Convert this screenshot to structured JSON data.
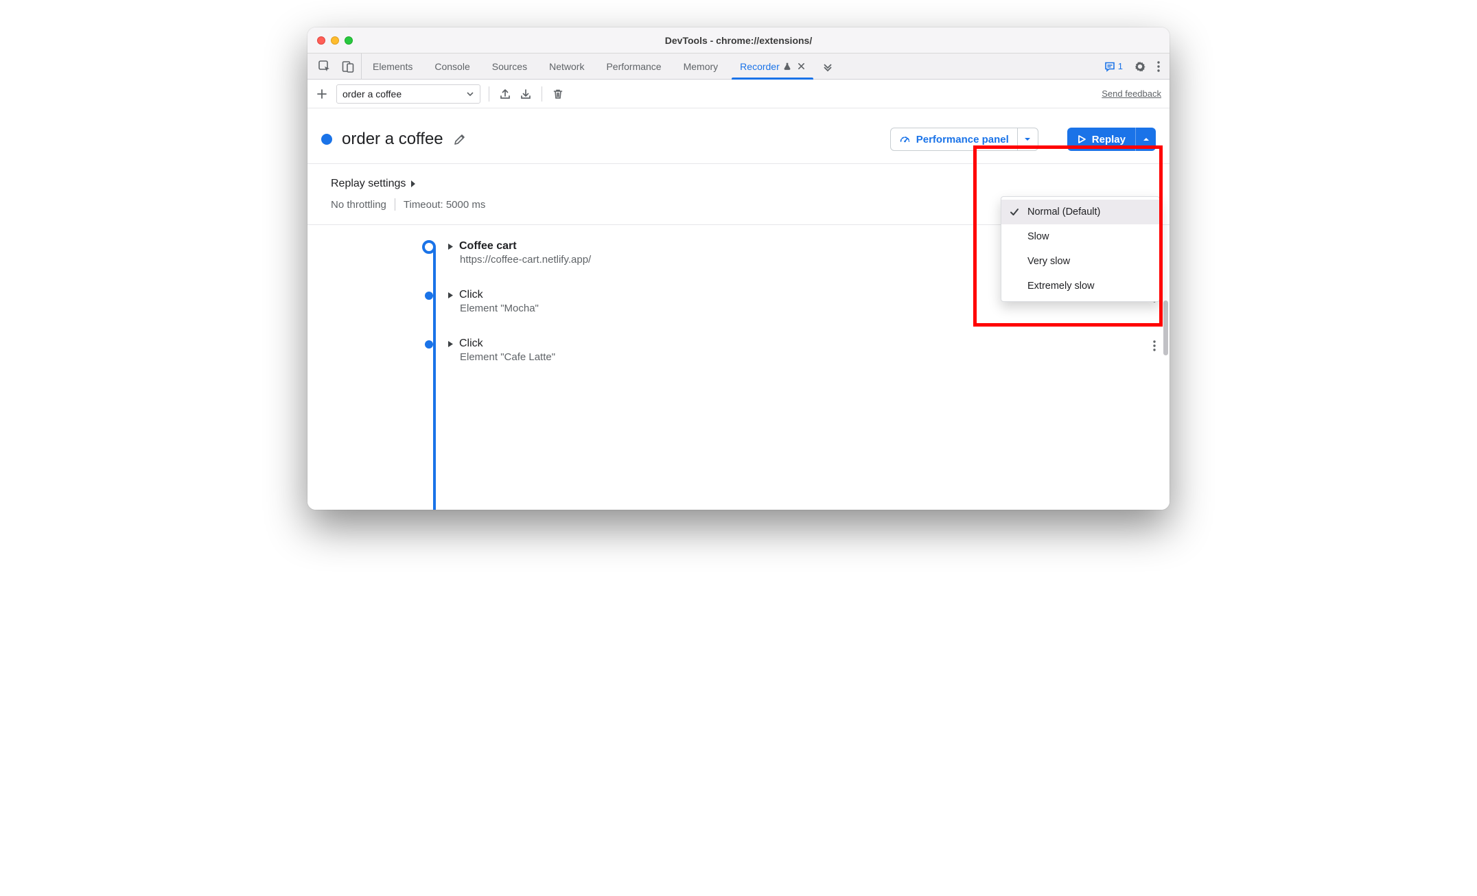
{
  "window": {
    "title": "DevTools - chrome://extensions/"
  },
  "tabs": {
    "items": [
      "Elements",
      "Console",
      "Sources",
      "Network",
      "Performance",
      "Memory",
      "Recorder"
    ],
    "active": "Recorder"
  },
  "issues_count": "1",
  "toolbar": {
    "recording_select": "order a coffee",
    "feedback": "Send feedback"
  },
  "header": {
    "recording_name": "order a coffee",
    "performance_label": "Performance panel",
    "replay_label": "Replay"
  },
  "settings": {
    "heading": "Replay settings",
    "throttling": "No throttling",
    "timeout": "Timeout: 5000 ms"
  },
  "replay_menu": {
    "items": [
      {
        "label": "Normal (Default)",
        "selected": true
      },
      {
        "label": "Slow",
        "selected": false
      },
      {
        "label": "Very slow",
        "selected": false
      },
      {
        "label": "Extremely slow",
        "selected": false
      }
    ]
  },
  "steps": [
    {
      "title": "Coffee cart",
      "subtitle": "https://coffee-cart.netlify.app/",
      "first": true
    },
    {
      "title": "Click",
      "subtitle": "Element \"Mocha\"",
      "first": false
    },
    {
      "title": "Click",
      "subtitle": "Element \"Cafe Latte\"",
      "first": false
    }
  ]
}
